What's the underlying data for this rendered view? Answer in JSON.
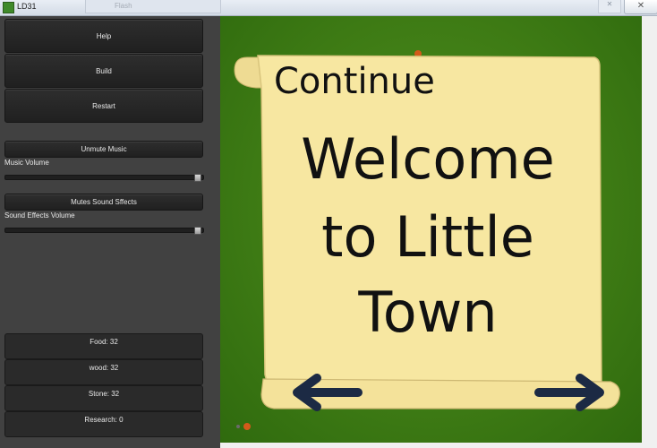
{
  "window": {
    "title": "LD31",
    "close_glyph": "✕",
    "ghost_tab_label": "Flash"
  },
  "sidebar": {
    "buttons": {
      "help": "Help",
      "build": "Build",
      "restart": "Restart"
    },
    "music_toggle": "Unmute Music",
    "music_volume_label": "Music Volume",
    "music_volume_level": 1.0,
    "sound_toggle": "Mutes Sound Sffects",
    "sfx_volume_label": "Sound Effects Volume",
    "sfx_volume_level": 1.0,
    "resources": {
      "food": "Food: 32",
      "wood": "wood: 32",
      "stone": "Stone: 32",
      "research": "Research: 0"
    }
  },
  "scroll": {
    "continue_label": "Continue",
    "welcome_lines": [
      "Welcome",
      "to Little",
      "Town"
    ],
    "left_arrow_icon": "arrow-left-icon",
    "right_arrow_icon": "arrow-right-icon"
  },
  "colors": {
    "grass": "#3d7a14",
    "parchment": "#f7e7a1",
    "arrow": "#1c2a44",
    "sidebar_bg": "#414141"
  }
}
